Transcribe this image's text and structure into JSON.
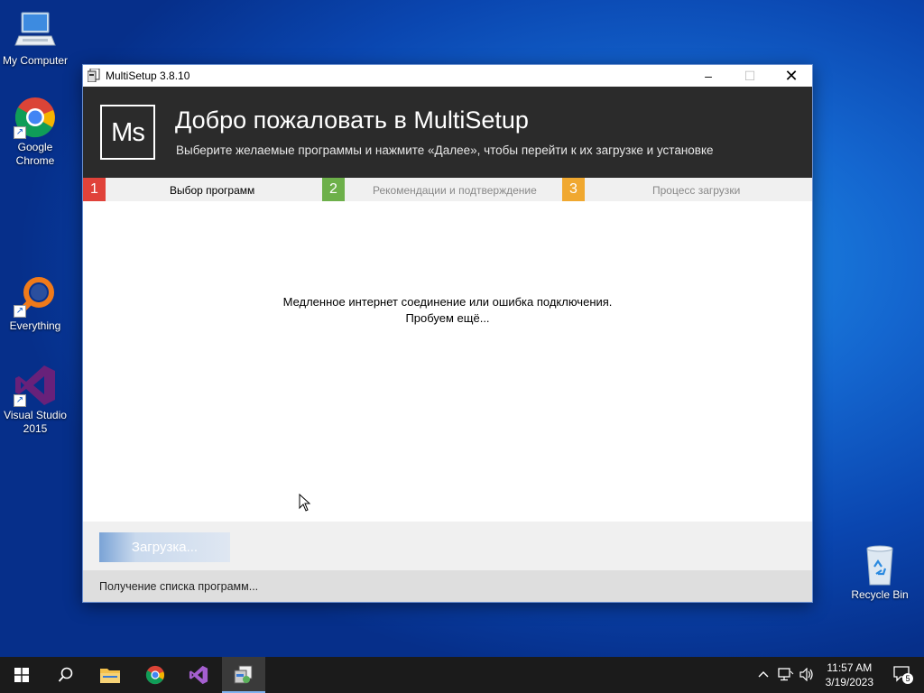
{
  "desktop": {
    "icons": [
      {
        "label": "My Computer",
        "icon": "computer-icon"
      },
      {
        "label": "Google Chrome",
        "icon": "chrome-icon"
      },
      {
        "label": "Everything",
        "icon": "everything-icon"
      },
      {
        "label": "Visual Studio 2015",
        "icon": "visual-studio-icon"
      },
      {
        "label": "Recycle Bin",
        "icon": "recycle-bin-icon"
      }
    ]
  },
  "window": {
    "title": "MultiSetup 3.8.10",
    "minimize": "–",
    "maximize": "☐",
    "close": "✕",
    "header": {
      "logo": "Ms",
      "title": "Добро пожаловать в MultiSetup",
      "subtitle": "Выберите желаемые программы и нажмите «Далее», чтобы перейти к их загрузке и установке"
    },
    "steps": [
      {
        "num": "1",
        "label": "Выбор программ",
        "color": "#e0423a"
      },
      {
        "num": "2",
        "label": "Рекомендации и подтверждение",
        "color": "#6db04a"
      },
      {
        "num": "3",
        "label": "Процесс загрузки",
        "color": "#f0a830"
      }
    ],
    "message_line1": "Медленное интернет соединение или ошибка подключения.",
    "message_line2": "Пробуем ещё...",
    "load_button": "Загрузка...",
    "status": "Получение списка программ..."
  },
  "taskbar": {
    "items": [
      "start-icon",
      "search-icon",
      "file-explorer-icon",
      "chrome-icon",
      "visual-studio-icon",
      "multisetup-icon"
    ],
    "time": "11:57 AM",
    "date": "3/19/2023",
    "notification_count": "5"
  },
  "colors": {
    "accent": "#1466cf",
    "header_bg": "#2b2b2b"
  }
}
